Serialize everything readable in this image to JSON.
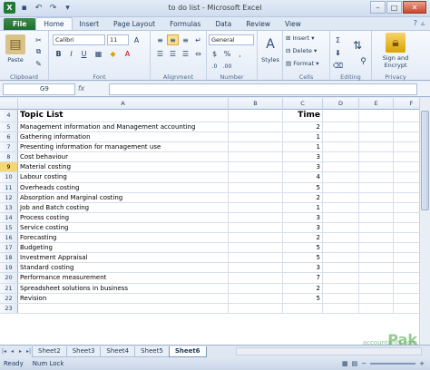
{
  "app": {
    "title": "to do list - Microsoft Excel",
    "file_tab": "File",
    "tabs": [
      "Home",
      "Insert",
      "Page Layout",
      "Formulas",
      "Data",
      "Review",
      "View"
    ],
    "active_tab": "Home"
  },
  "ribbon": {
    "clipboard": {
      "label": "Clipboard",
      "paste": "Paste"
    },
    "font": {
      "label": "Font",
      "name": "Calibri",
      "size": "11"
    },
    "alignment": {
      "label": "Alignment"
    },
    "number": {
      "label": "Number",
      "format": "General"
    },
    "styles": {
      "label": "Styles"
    },
    "cells": {
      "label": "Cells",
      "insert": "Insert",
      "delete": "Delete",
      "format": "Format"
    },
    "editing": {
      "label": "Editing"
    },
    "privacy": {
      "label": "Privacy",
      "sign": "Sign and",
      "encrypt": "Encrypt"
    }
  },
  "formula_bar": {
    "name_box": "G9",
    "fx": "fx",
    "value": ""
  },
  "grid": {
    "columns": [
      "A",
      "B",
      "C",
      "D",
      "E",
      "F"
    ],
    "header_row": {
      "num": "4",
      "a": "Topic List",
      "c": "Time"
    },
    "rows": [
      {
        "num": "5",
        "a": "Management information and Management accounting",
        "c": "2"
      },
      {
        "num": "6",
        "a": "Gathering information",
        "c": "1"
      },
      {
        "num": "7",
        "a": "Presenting information for management use",
        "c": "1"
      },
      {
        "num": "8",
        "a": "Cost behaviour",
        "c": "3"
      },
      {
        "num": "9",
        "a": "Material costing",
        "c": "3"
      },
      {
        "num": "10",
        "a": "Labour costing",
        "c": "4"
      },
      {
        "num": "11",
        "a": "Overheads costing",
        "c": "5"
      },
      {
        "num": "12",
        "a": "Absorption and Marginal costing",
        "c": "2"
      },
      {
        "num": "13",
        "a": "Job and Batch costing",
        "c": "1"
      },
      {
        "num": "14",
        "a": "Process costing",
        "c": "3"
      },
      {
        "num": "15",
        "a": "Service costing",
        "c": "3"
      },
      {
        "num": "16",
        "a": "Forecasting",
        "c": "2"
      },
      {
        "num": "17",
        "a": "Budgeting",
        "c": "5"
      },
      {
        "num": "18",
        "a": "Investment Appraisal",
        "c": "5"
      },
      {
        "num": "19",
        "a": "Standard costing",
        "c": "3"
      },
      {
        "num": "20",
        "a": "Performance measurement",
        "c": "7"
      },
      {
        "num": "21",
        "a": "Spreadsheet solutions in business",
        "c": "2"
      },
      {
        "num": "22",
        "a": "Revision",
        "c": "5"
      },
      {
        "num": "23",
        "a": "",
        "c": ""
      }
    ],
    "selected_row": "9"
  },
  "sheets": [
    "Sheet2",
    "Sheet3",
    "Sheet4",
    "Sheet5",
    "Sheet6"
  ],
  "active_sheet": "Sheet6",
  "status": {
    "ready": "Ready",
    "numlock": "Num Lock"
  },
  "watermark": {
    "brand": "Pak",
    "site": "accountants.com"
  }
}
